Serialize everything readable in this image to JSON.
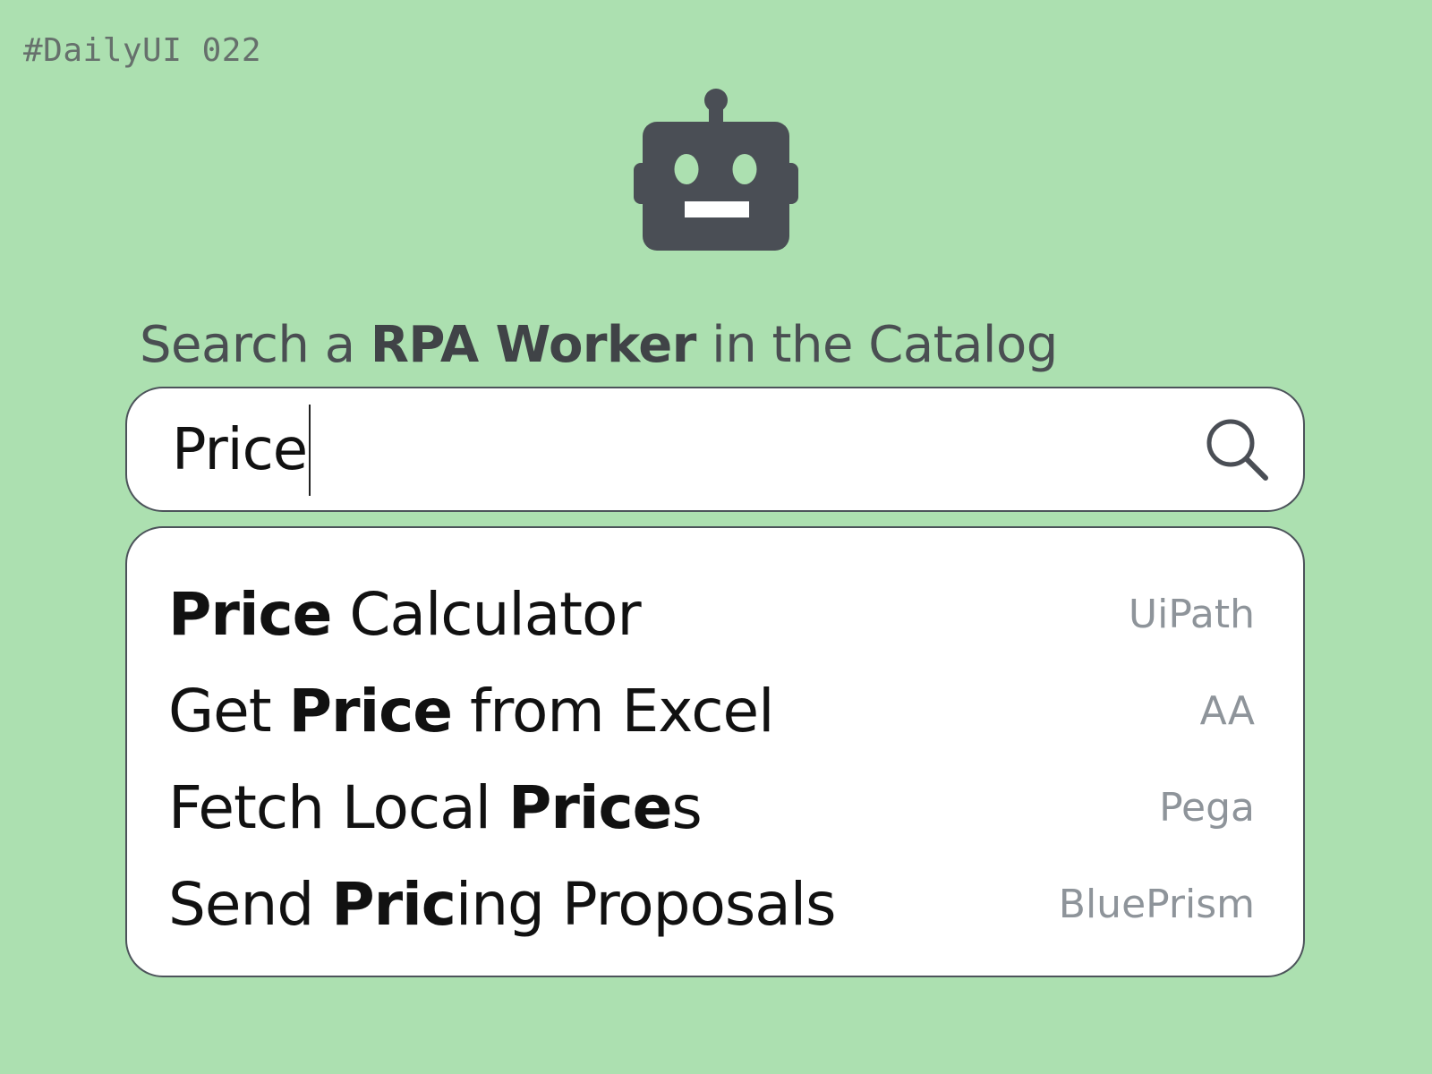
{
  "tag": "#DailyUI 022",
  "logo": {
    "icon": "robot-icon",
    "color": "#4a4e55"
  },
  "heading": {
    "prefix": "Search a ",
    "emphasis": "RPA Worker",
    "suffix": " in the Catalog"
  },
  "search": {
    "value": "Price",
    "icon": "search-icon"
  },
  "results": [
    {
      "bold": "Price",
      "rest": " Calculator",
      "pre": "",
      "vendor": "UiPath"
    },
    {
      "pre": "Get ",
      "bold": "Price",
      "rest": " from Excel",
      "vendor": "AA"
    },
    {
      "pre": "Fetch Local ",
      "bold": "Price",
      "rest": "s",
      "vendor": "Pega"
    },
    {
      "pre": "Send ",
      "bold": "Pric",
      "rest": "ing Proposals",
      "vendor": "BluePrism"
    }
  ],
  "colors": {
    "background": "#ace0b0",
    "border": "#4c535a",
    "vendor_text": "#8e949a"
  }
}
